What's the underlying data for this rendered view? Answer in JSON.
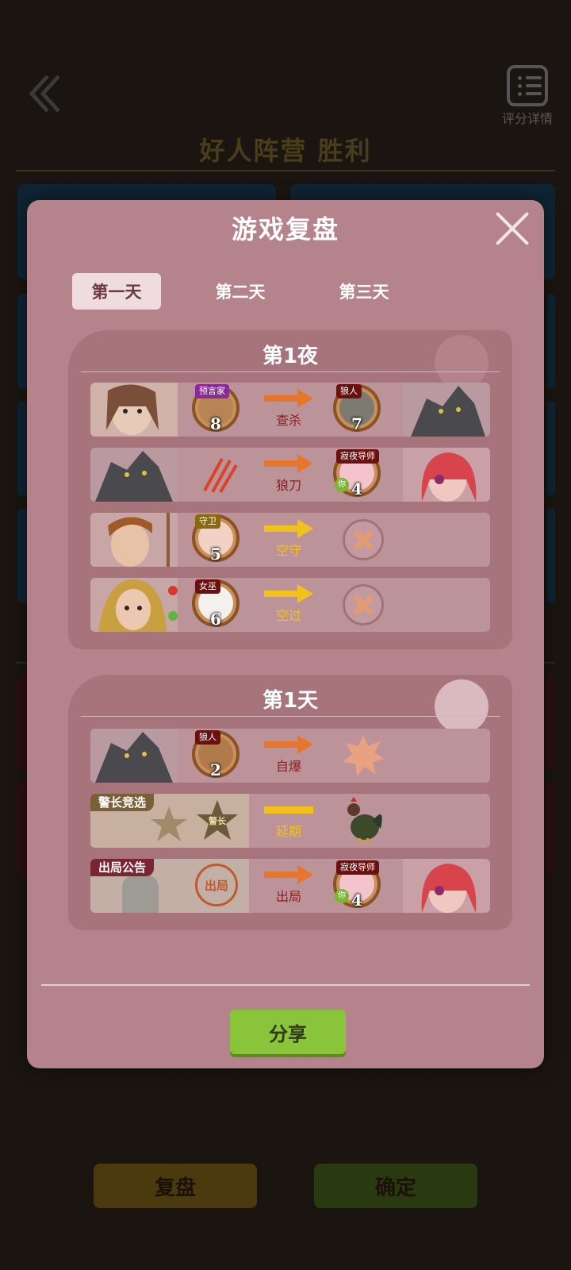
{
  "background": {
    "result_title": "好人阵营 胜利",
    "score_detail_label": "评分详情",
    "review_button": "复盘",
    "confirm_button": "确定"
  },
  "modal": {
    "title": "游戏复盘",
    "tabs": [
      "第一天",
      "第二天",
      "第三天"
    ],
    "active_tab": 0,
    "share_button": "分享"
  },
  "night": {
    "title": "第1夜",
    "rows": [
      {
        "actor_role": "预言家",
        "actor_seat": "8",
        "action": "查杀",
        "target_role": "狼人",
        "target_seat": "7"
      },
      {
        "actor_role": "",
        "actor_seat": "",
        "action": "狼刀",
        "target_role": "寂夜导师",
        "target_seat": "4",
        "target_you": "你"
      },
      {
        "actor_role": "守卫",
        "actor_seat": "5",
        "action": "空守",
        "target_role": "",
        "target_seat": ""
      },
      {
        "actor_role": "女巫",
        "actor_seat": "6",
        "action": "空过",
        "target_role": "",
        "target_seat": ""
      }
    ]
  },
  "day": {
    "title": "第1天",
    "rows": [
      {
        "actor_role": "狼人",
        "actor_seat": "2",
        "action": "自爆"
      },
      {
        "banner": "警长竞选",
        "badge_text": "警长",
        "action": "延期"
      },
      {
        "banner": "出局公告",
        "stamp_text": "出局",
        "action": "出局",
        "target_role": "寂夜导师",
        "target_seat": "4",
        "target_you": "你"
      }
    ]
  },
  "colors": {
    "modal_bg": "#b5838b",
    "section_bg": "#a7747c",
    "row_bg": "#bd939a",
    "share_green": "#8ac43a",
    "arrow_orange": "#e8762a",
    "arrow_yellow": "#f1c21a",
    "action_red": "#8a2020"
  }
}
